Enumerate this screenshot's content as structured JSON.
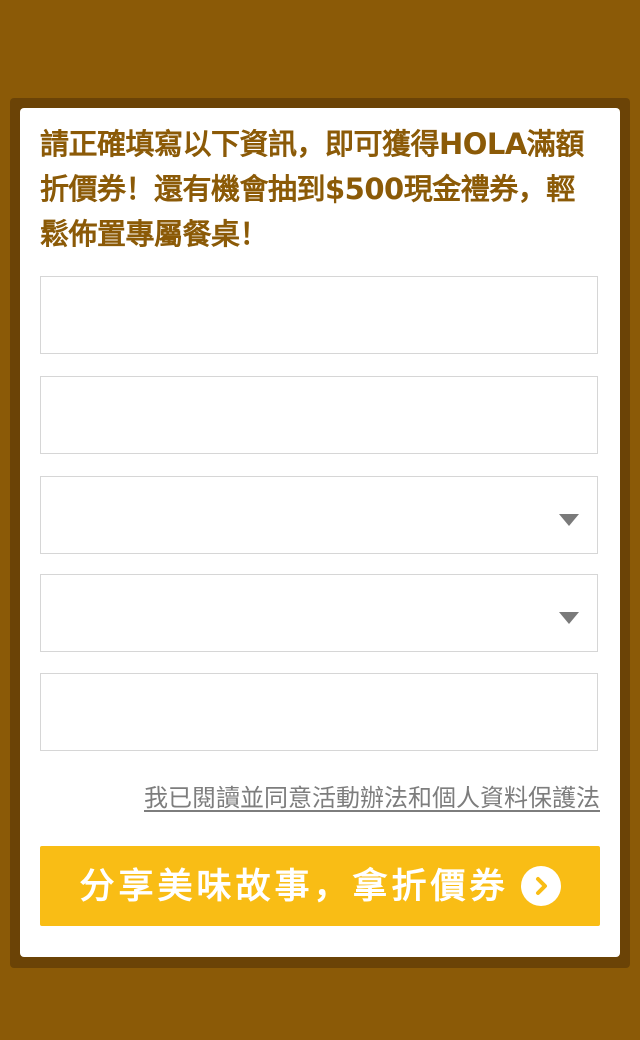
{
  "colors": {
    "page_background": "#8b5a07",
    "frame_border": "#6b4306",
    "card_background": "#ffffff",
    "heading_text": "#8b5a07",
    "field_border": "#d6d6d6",
    "link_text": "#7d7d7d",
    "cta_background": "#f9bd15",
    "cta_text": "#ffffff"
  },
  "form": {
    "intro_text": "請正確填寫以下資訊，即可獲得HOLA滿額折價券！還有機會抽到$500現金禮券，輕鬆佈置專屬餐桌！",
    "fields": [
      {
        "value": "",
        "placeholder": ""
      },
      {
        "value": "",
        "placeholder": ""
      },
      {
        "selected": "",
        "icon": "chevron-down-icon"
      },
      {
        "selected": "",
        "icon": "chevron-down-icon"
      },
      {
        "value": "",
        "placeholder": ""
      }
    ],
    "agree_link": "我已閱讀並同意活動辦法和個人資料保護法",
    "submit_label": "分享美味故事，拿折價券",
    "submit_icon": "chevron-right-circle-icon"
  }
}
